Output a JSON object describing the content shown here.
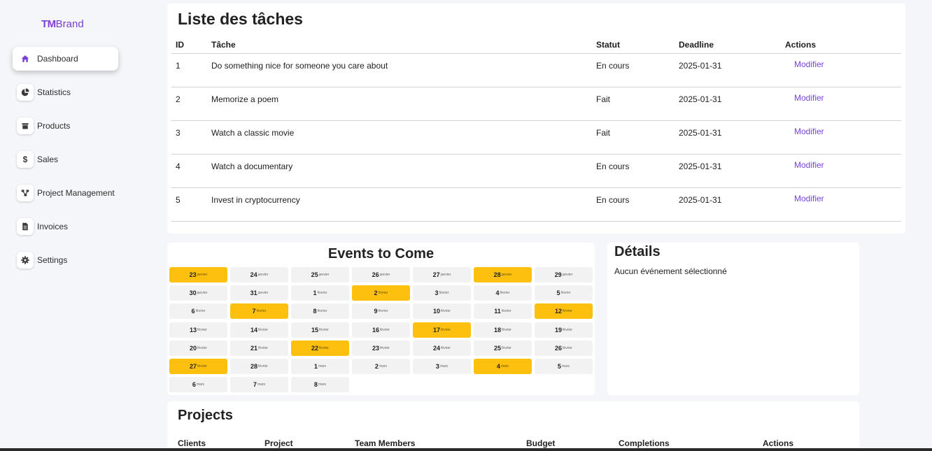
{
  "brand": {
    "mark": "TM",
    "name": "Brand"
  },
  "sidebar": {
    "items": [
      {
        "label": "Dashboard",
        "icon": "home-icon",
        "active": true
      },
      {
        "label": "Statistics",
        "icon": "pie-chart-icon"
      },
      {
        "label": "Products",
        "icon": "box-icon"
      },
      {
        "label": "Sales",
        "icon": "dollar-icon"
      },
      {
        "label": "Project Management",
        "icon": "network-icon"
      },
      {
        "label": "Invoices",
        "icon": "document-icon"
      },
      {
        "label": "Settings",
        "icon": "gear-icon"
      }
    ]
  },
  "tasks": {
    "title": "Liste des tâches",
    "columns": {
      "id": "ID",
      "task": "Tâche",
      "status": "Statut",
      "deadline": "Deadline",
      "actions": "Actions"
    },
    "rows": [
      {
        "id": "1",
        "task": "Do something nice for someone you care about",
        "status": "En cours",
        "deadline": "2025-01-31",
        "action": "Modifier"
      },
      {
        "id": "2",
        "task": "Memorize a poem",
        "status": "Fait",
        "deadline": "2025-01-31",
        "action": "Modifier"
      },
      {
        "id": "3",
        "task": "Watch a classic movie",
        "status": "Fait",
        "deadline": "2025-01-31",
        "action": "Modifier"
      },
      {
        "id": "4",
        "task": "Watch a documentary",
        "status": "En cours",
        "deadline": "2025-01-31",
        "action": "Modifier"
      },
      {
        "id": "5",
        "task": "Invest in cryptocurrency",
        "status": "En cours",
        "deadline": "2025-01-31",
        "action": "Modifier"
      }
    ]
  },
  "events": {
    "title": "Events to Come",
    "highlight_color": "#fdc00f",
    "days": [
      {
        "day": "23",
        "month": "janvier",
        "event": true
      },
      {
        "day": "24",
        "month": "janvier",
        "event": false
      },
      {
        "day": "25",
        "month": "janvier",
        "event": false
      },
      {
        "day": "26",
        "month": "janvier",
        "event": false
      },
      {
        "day": "27",
        "month": "janvier",
        "event": false
      },
      {
        "day": "28",
        "month": "janvier",
        "event": true
      },
      {
        "day": "29",
        "month": "janvier",
        "event": false
      },
      {
        "day": "30",
        "month": "janvier",
        "event": false
      },
      {
        "day": "31",
        "month": "janvier",
        "event": false
      },
      {
        "day": "1",
        "month": "février",
        "event": false
      },
      {
        "day": "2",
        "month": "février",
        "event": true
      },
      {
        "day": "3",
        "month": "février",
        "event": false
      },
      {
        "day": "4",
        "month": "février",
        "event": false
      },
      {
        "day": "5",
        "month": "février",
        "event": false
      },
      {
        "day": "6",
        "month": "février",
        "event": false
      },
      {
        "day": "7",
        "month": "février",
        "event": true
      },
      {
        "day": "8",
        "month": "février",
        "event": false
      },
      {
        "day": "9",
        "month": "février",
        "event": false
      },
      {
        "day": "10",
        "month": "février",
        "event": false
      },
      {
        "day": "11",
        "month": "février",
        "event": false
      },
      {
        "day": "12",
        "month": "février",
        "event": true
      },
      {
        "day": "13",
        "month": "février",
        "event": false
      },
      {
        "day": "14",
        "month": "février",
        "event": false
      },
      {
        "day": "15",
        "month": "février",
        "event": false
      },
      {
        "day": "16",
        "month": "février",
        "event": false
      },
      {
        "day": "17",
        "month": "février",
        "event": true
      },
      {
        "day": "18",
        "month": "février",
        "event": false
      },
      {
        "day": "19",
        "month": "février",
        "event": false
      },
      {
        "day": "20",
        "month": "février",
        "event": false
      },
      {
        "day": "21",
        "month": "février",
        "event": false
      },
      {
        "day": "22",
        "month": "février",
        "event": true
      },
      {
        "day": "23",
        "month": "février",
        "event": false
      },
      {
        "day": "24",
        "month": "février",
        "event": false
      },
      {
        "day": "25",
        "month": "février",
        "event": false
      },
      {
        "day": "26",
        "month": "février",
        "event": false
      },
      {
        "day": "27",
        "month": "février",
        "event": true
      },
      {
        "day": "28",
        "month": "février",
        "event": false
      },
      {
        "day": "1",
        "month": "mars",
        "event": false
      },
      {
        "day": "2",
        "month": "mars",
        "event": false
      },
      {
        "day": "3",
        "month": "mars",
        "event": false
      },
      {
        "day": "4",
        "month": "mars",
        "event": true
      },
      {
        "day": "5",
        "month": "mars",
        "event": false
      },
      {
        "day": "6",
        "month": "mars",
        "event": false
      },
      {
        "day": "7",
        "month": "mars",
        "event": false
      },
      {
        "day": "8",
        "month": "mars",
        "event": false
      }
    ]
  },
  "details": {
    "title": "Détails",
    "empty_text": "Aucun événement sélectionné"
  },
  "projects": {
    "title": "Projects",
    "columns": [
      "Clients",
      "Project",
      "Team Members",
      "Budget",
      "Completions",
      "Actions"
    ]
  }
}
